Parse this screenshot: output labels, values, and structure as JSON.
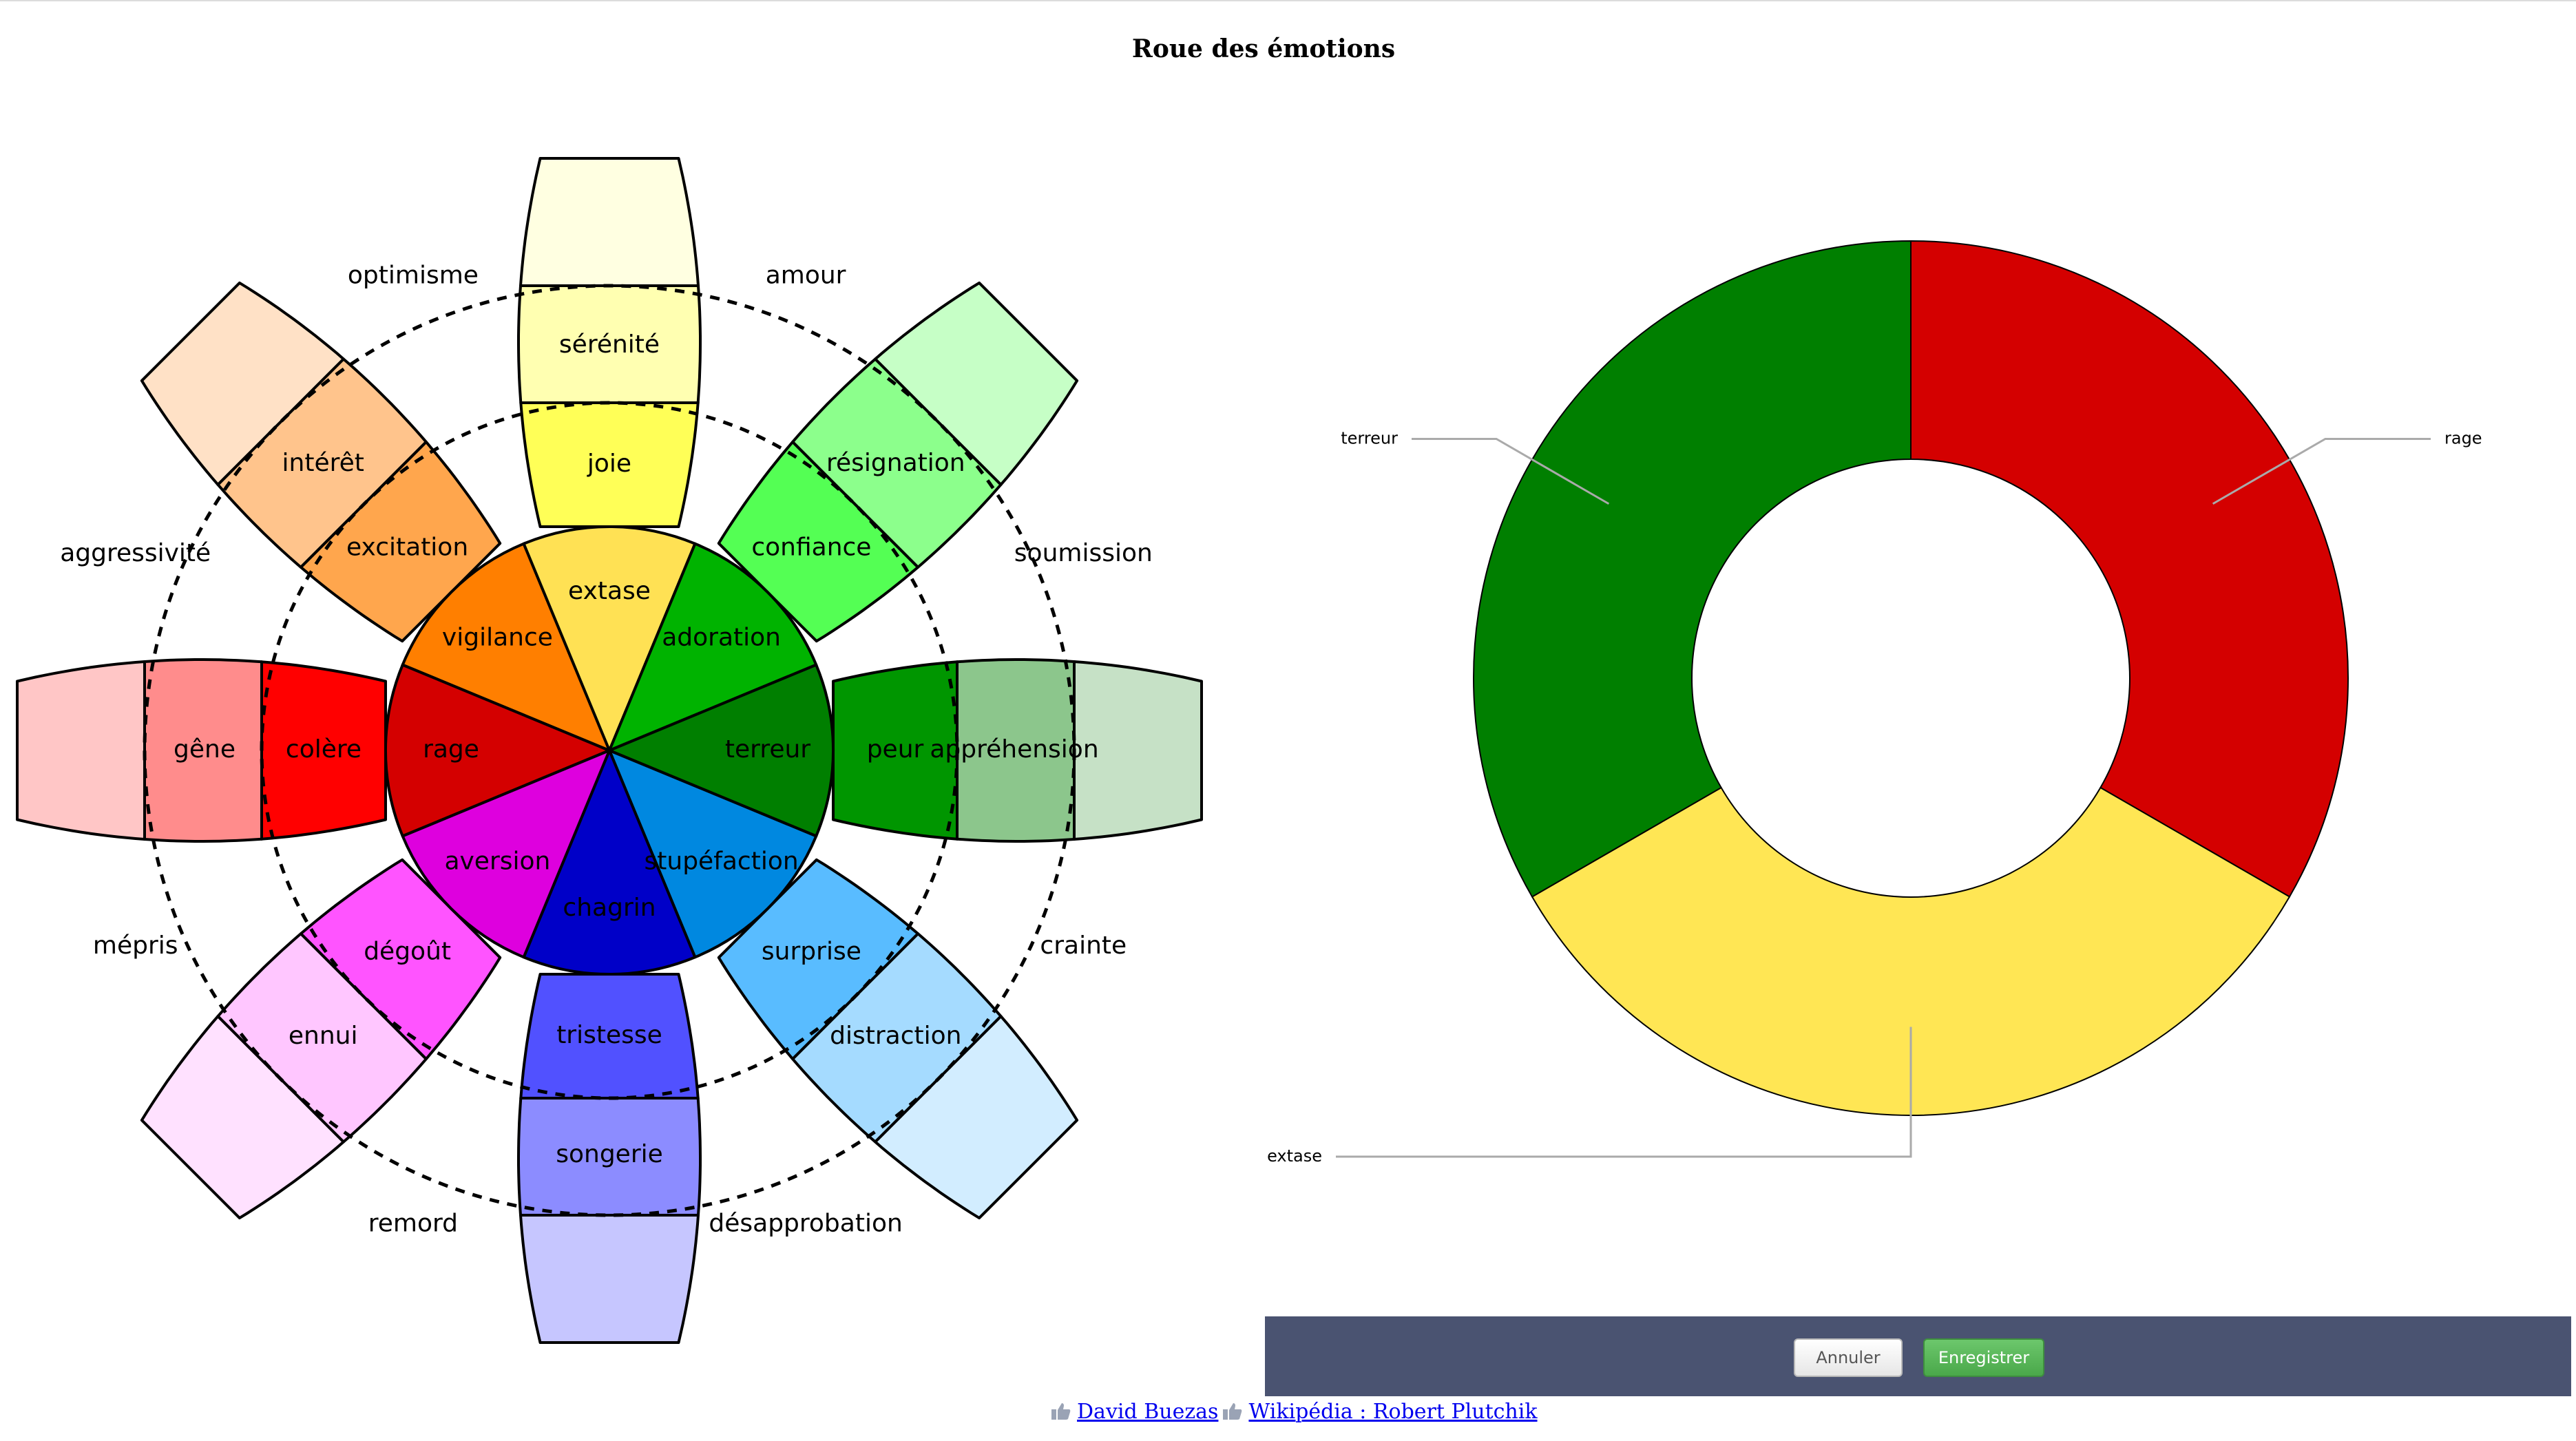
{
  "title": "Roue des émotions",
  "wheel": {
    "center": [
      "rage",
      "vigilance",
      "extase",
      "adoration",
      "terreur",
      "stupéfaction",
      "chagrin",
      "aversion"
    ],
    "middle": [
      "colère",
      "excitation",
      "joie",
      "confiance",
      "peur",
      "surprise",
      "tristesse",
      "dégoût"
    ],
    "outer": [
      "gêne",
      "intérêt",
      "sérénité",
      "résignation",
      "appréhension",
      "distraction",
      "songerie",
      "ennui"
    ],
    "dyads": [
      "aggressivité",
      "optimisme",
      "amour",
      "soumission",
      "crainte",
      "désapprobation",
      "remord",
      "mépris"
    ],
    "center_colors": [
      "#d40000",
      "#ff7f00",
      "#ffe154",
      "#00b300",
      "#007f00",
      "#0088e0",
      "#0000c8",
      "#de00de"
    ],
    "middle_colors": [
      "#ff0000",
      "#ffa64d",
      "#ffff57",
      "#54ff54",
      "#009600",
      "#59bcff",
      "#5151ff",
      "#ff54ff"
    ],
    "outer_colors": [
      "#ff8c8c",
      "#ffc48c",
      "#ffffb1",
      "#8cff8c",
      "#8cc68c",
      "#a5dbff",
      "#8c8cff",
      "#ffc6ff"
    ],
    "tip_colors": [
      "#ffc6c6",
      "#ffe1c6",
      "#ffffe1",
      "#c6ffc6",
      "#c6e1c6",
      "#d2edff",
      "#c6c6ff",
      "#ffe1ff"
    ]
  },
  "chart_data": {
    "type": "pie",
    "categories": [
      "rage",
      "extase",
      "terreur"
    ],
    "values": [
      1,
      1,
      1
    ],
    "colors": [
      "#d40000",
      "#ffe654",
      "#007f00"
    ]
  },
  "buttons": {
    "cancel": "Annuler",
    "save": "Enregistrer"
  },
  "links": {
    "author": "David Buezas",
    "wiki": "Wikipédia : Robert Plutchik"
  }
}
